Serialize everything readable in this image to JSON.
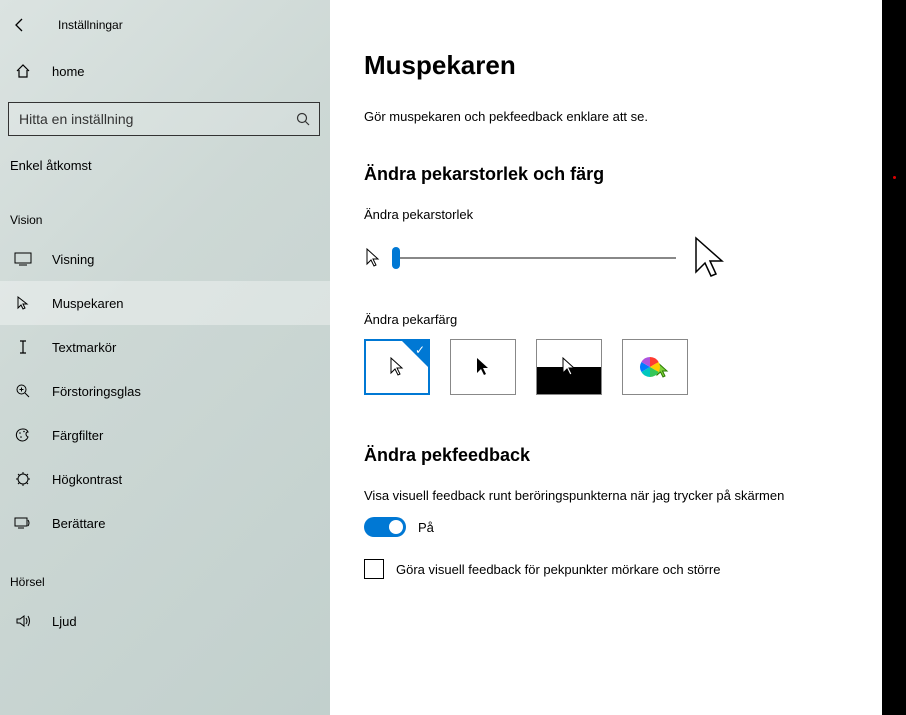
{
  "header": {
    "app_title": "Inställningar",
    "home_label": "home",
    "search_placeholder": "Hitta en inställning"
  },
  "sidebar": {
    "section_label": "Enkel åtkomst",
    "categories": [
      {
        "name": "Vision",
        "items": [
          {
            "id": "visning",
            "label": "Visning",
            "icon": "display-icon",
            "selected": false
          },
          {
            "id": "muspekaren",
            "label": "Muspekaren",
            "icon": "pointer-icon",
            "selected": true
          },
          {
            "id": "textmarkor",
            "label": "Textmarkör",
            "icon": "text-cursor-icon",
            "selected": false
          },
          {
            "id": "forstoringsglas",
            "label": "Förstoringsglas",
            "icon": "magnifier-icon",
            "selected": false
          },
          {
            "id": "fargfilter",
            "label": "Färgfilter",
            "icon": "palette-icon",
            "selected": false
          },
          {
            "id": "hogkontrast",
            "label": "Högkontrast",
            "icon": "contrast-icon",
            "selected": false
          },
          {
            "id": "berattare",
            "label": "Berättare",
            "icon": "narrator-icon",
            "selected": false
          }
        ]
      },
      {
        "name": "Hörsel",
        "items": [
          {
            "id": "ljud",
            "label": "Ljud",
            "icon": "speaker-icon",
            "selected": false
          }
        ]
      }
    ]
  },
  "main": {
    "title": "Muspekaren",
    "subtitle": "Gör muspekaren och pekfeedback enklare att se.",
    "section1_heading": "Ändra pekarstorlek och färg",
    "size_label": "Ändra pekarstorlek",
    "color_label": "Ändra pekarfärg",
    "color_tiles": [
      {
        "id": "white",
        "selected": true
      },
      {
        "id": "black",
        "selected": false
      },
      {
        "id": "inverted",
        "selected": false
      },
      {
        "id": "custom",
        "selected": false
      }
    ],
    "section2_heading": "Ändra pekfeedback",
    "feedback_toggle_label": "Visa visuell feedback runt beröringspunkterna när jag trycker på skärmen",
    "toggle_state": "På",
    "toggle_on": true,
    "checkbox_label": "Göra visuell feedback för pekpunkter mörkare och större",
    "checkbox_checked": false
  }
}
